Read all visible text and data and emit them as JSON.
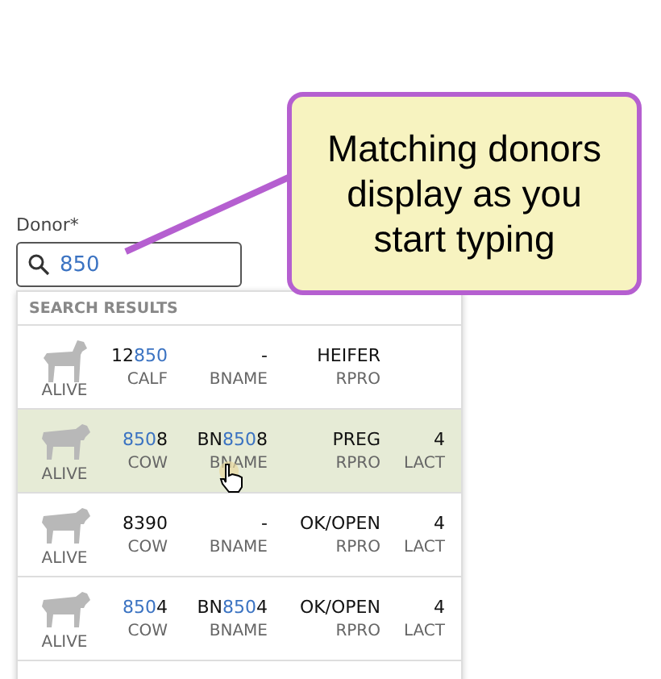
{
  "donor_field": {
    "label": "Donor*",
    "value": "850"
  },
  "results": {
    "header": "SEARCH RESULTS",
    "rows": [
      {
        "kind": "calf",
        "status": "ALIVE",
        "id": [
          {
            "text": "12",
            "match": false
          },
          {
            "text": "850",
            "match": true
          }
        ],
        "id_label": "CALF",
        "bname": [
          {
            "text": "-",
            "match": false
          }
        ],
        "bname_label": "BNAME",
        "repro": "HEIFER",
        "repro_label": "RPRO",
        "hovered": false
      },
      {
        "kind": "cow",
        "status": "ALIVE",
        "id": [
          {
            "text": "850",
            "match": true
          },
          {
            "text": "8",
            "match": false
          }
        ],
        "id_label": "COW",
        "bname": [
          {
            "text": "BN",
            "match": false
          },
          {
            "text": "850",
            "match": true
          },
          {
            "text": "8",
            "match": false
          }
        ],
        "bname_label": "BNAME",
        "repro": "PREG",
        "repro_label": "RPRO",
        "lact": "4",
        "lact_label": "LACT",
        "hovered": true
      },
      {
        "kind": "cow",
        "status": "ALIVE",
        "id": [
          {
            "text": "8390",
            "match": false
          }
        ],
        "id_label": "COW",
        "bname": [
          {
            "text": "-",
            "match": false
          }
        ],
        "bname_label": "BNAME",
        "repro": "OK/OPEN",
        "repro_label": "RPRO",
        "lact": "4",
        "lact_label": "LACT",
        "hovered": false
      },
      {
        "kind": "cow",
        "status": "ALIVE",
        "id": [
          {
            "text": "850",
            "match": true
          },
          {
            "text": "4",
            "match": false
          }
        ],
        "id_label": "COW",
        "bname": [
          {
            "text": "BN",
            "match": false
          },
          {
            "text": "850",
            "match": true
          },
          {
            "text": "4",
            "match": false
          }
        ],
        "bname_label": "BNAME",
        "repro": "OK/OPEN",
        "repro_label": "RPRO",
        "lact": "4",
        "lact_label": "LACT",
        "hovered": false
      }
    ]
  },
  "callout": {
    "text": "Matching donors display as you start typing"
  }
}
